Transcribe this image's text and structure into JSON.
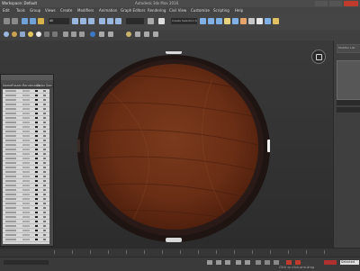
{
  "titlebar": {
    "workspace": "Workspace: Default",
    "document": "Autodesk 3ds Max 2016"
  },
  "menubar": {
    "items": [
      "Edit",
      "Tools",
      "Group",
      "Views",
      "Create",
      "Modifiers",
      "Animation",
      "Graph Editors",
      "Rendering",
      "Civil View",
      "Customize",
      "Scripting",
      "Help"
    ]
  },
  "toolbar": {
    "selection_filter": "All",
    "named_selection": "Create Selection Set"
  },
  "scene_explorer": {
    "columns": [
      "Name",
      "Frozen",
      "Renderable",
      "Color",
      "See"
    ]
  },
  "right_panel": {
    "header": "Modifier List"
  },
  "status": {
    "selected": "Selected",
    "tip": "Click or click-and-drag"
  },
  "colors": {
    "wood_light": "#7a3a1c",
    "wood_dark": "#4a1d0c",
    "rim": "#2a1a17",
    "viewport_bg": "#333333"
  }
}
